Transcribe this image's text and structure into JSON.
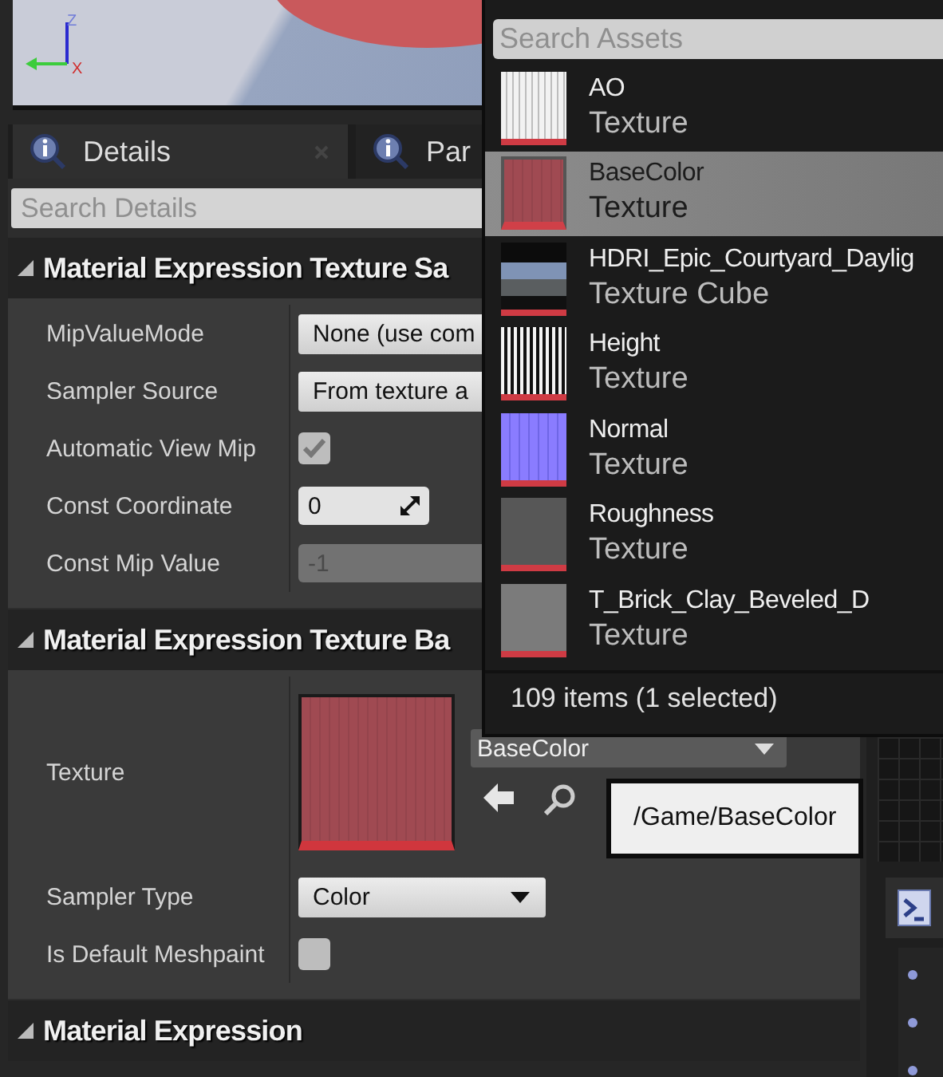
{
  "viewport": {
    "axis_labels": [
      "Z",
      "X"
    ]
  },
  "tabs": [
    {
      "label": "Details",
      "selected": true,
      "closable": true
    },
    {
      "label": "Par",
      "selected": false,
      "closable": false
    }
  ],
  "details_search": {
    "placeholder": "Search Details"
  },
  "sections": [
    {
      "title": "Material Expression Texture Sa",
      "expanded": true,
      "properties": [
        {
          "kind": "dropdown",
          "label": "MipValueMode",
          "value": "None (use com"
        },
        {
          "kind": "dropdown",
          "label": "Sampler Source",
          "value": "From texture a"
        },
        {
          "kind": "checkbox",
          "label": "Automatic View Mip",
          "checked": true
        },
        {
          "kind": "number",
          "label": "Const Coordinate",
          "value": "0",
          "disabled": false
        },
        {
          "kind": "number",
          "label": "Const Mip Value",
          "value": "-1",
          "disabled": true
        }
      ]
    },
    {
      "title": "Material Expression Texture Ba",
      "expanded": true,
      "properties": [
        {
          "kind": "asset",
          "label": "Texture",
          "value": "BaseColor",
          "tooltip": "/Game/BaseColor"
        },
        {
          "kind": "dropdown",
          "label": "Sampler Type",
          "value": "Color"
        },
        {
          "kind": "checkbox",
          "label": "Is Default Meshpaint",
          "checked": false
        }
      ]
    },
    {
      "title": "Material Expression",
      "expanded": true
    }
  ],
  "asset_picker": {
    "search": {
      "placeholder": "Search Assets"
    },
    "assets": [
      {
        "name": "AO",
        "type": "Texture",
        "kind": "white-stripes",
        "selected": false
      },
      {
        "name": "BaseColor",
        "type": "Texture",
        "kind": "red",
        "selected": true
      },
      {
        "name": "HDRI_Epic_Courtyard_Daylig",
        "type": "Texture Cube",
        "kind": "panorama",
        "selected": false
      },
      {
        "name": "Height",
        "type": "Texture",
        "kind": "black-white-stripes",
        "selected": false
      },
      {
        "name": "Normal",
        "type": "Texture",
        "kind": "blue",
        "selected": false
      },
      {
        "name": "Roughness",
        "type": "Texture",
        "kind": "dark-grey",
        "selected": false
      },
      {
        "name": "T_Brick_Clay_Beveled_D",
        "type": "Texture",
        "kind": "grey",
        "selected": false
      }
    ],
    "status": "109 items (1 selected)"
  }
}
